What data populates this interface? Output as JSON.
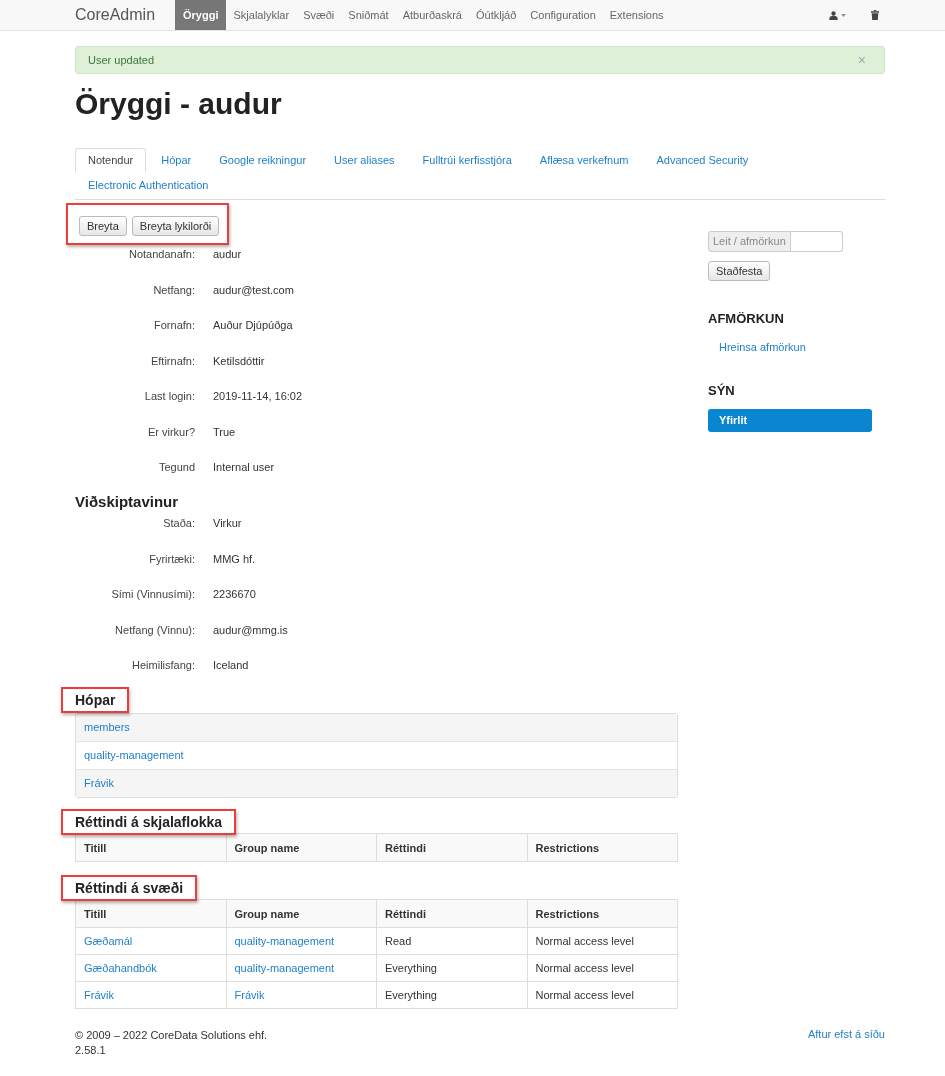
{
  "navbar": {
    "brand": "CoreAdmin",
    "items": [
      {
        "label": "Öryggi",
        "selected": true
      },
      {
        "label": "Skjalalyklar",
        "selected": false
      },
      {
        "label": "Svæði",
        "selected": false
      },
      {
        "label": "Sniðmát",
        "selected": false
      },
      {
        "label": "Atburðaskrá",
        "selected": false
      },
      {
        "label": "Óútkljáð",
        "selected": false
      },
      {
        "label": "Configuration",
        "selected": false
      },
      {
        "label": "Extensions",
        "selected": false
      }
    ]
  },
  "alert": {
    "message": "User updated",
    "close": "×"
  },
  "title": "Öryggi - audur",
  "tabs": [
    {
      "label": "Notendur",
      "selected": true
    },
    {
      "label": "Hópar",
      "selected": false
    },
    {
      "label": "Google reikningur",
      "selected": false
    },
    {
      "label": "User aliases",
      "selected": false
    },
    {
      "label": "Fulltrúi kerfisstjóra",
      "selected": false
    },
    {
      "label": "Aflæsa verkefnum",
      "selected": false
    },
    {
      "label": "Advanced Security",
      "selected": false
    },
    {
      "label": "Electronic Authentication",
      "selected": false
    }
  ],
  "actions": {
    "highlighted": true,
    "buttons": [
      "Breyta",
      "Breyta lykilorði"
    ]
  },
  "user_fields": [
    {
      "label": "Notandanafn:",
      "value": "audur"
    },
    {
      "label": "Netfang:",
      "value": "audur@test.com"
    },
    {
      "label": "Fornafn:",
      "value": "Auður Djúpúðga"
    },
    {
      "label": "Eftirnafn:",
      "value": "Ketilsdóttir"
    },
    {
      "label": "Last login:",
      "value": "2019-11-14, 16:02"
    },
    {
      "label": "Er virkur?",
      "value": "True"
    },
    {
      "label": "Tegund",
      "value": "Internal user"
    }
  ],
  "customer": {
    "heading": "Viðskiptavinur",
    "fields": [
      {
        "label": "Staða:",
        "value": "Virkur"
      },
      {
        "label": "Fyrirtæki:",
        "value": "MMG hf."
      },
      {
        "label": "Sími (Vinnusími):",
        "value": "2236670"
      },
      {
        "label": "Netfang (Vinnu):",
        "value": "audur@mmg.is"
      },
      {
        "label": "Heimilisfang:",
        "value": "Iceland"
      }
    ]
  },
  "groups": {
    "heading": "Hópar",
    "highlighted": true,
    "items": [
      "members",
      "quality-management",
      "Frávik"
    ]
  },
  "permission_tables": [
    {
      "heading": "Réttindi á skjalaflokka",
      "highlighted": true,
      "columns": [
        "Titill",
        "Group name",
        "Réttindi",
        "Restrictions"
      ]
    },
    {
      "heading": "Réttindi á svæði",
      "highlighted": true,
      "columns": [
        "Titill",
        "Group name",
        "Réttindi",
        "Restrictions"
      ],
      "rows": [
        [
          "Gæðamál",
          "quality-management",
          "Read",
          "Normal access level"
        ],
        [
          "Gæðahandbók",
          "quality-management",
          "Everything",
          "Normal access level"
        ],
        [
          "Frávik",
          "Frávik",
          "Everything",
          "Normal access level"
        ]
      ]
    }
  ],
  "sidebar": {
    "search_label": "Leit / afmörkun",
    "confirm_button": "Staðfesta",
    "filter_heading": "AFMÖRKUN",
    "clear_filter": "Hreinsa afmörkun",
    "view_heading": "SÝN",
    "views": [
      {
        "label": "Yfirlit",
        "selected": true
      }
    ]
  },
  "footer": {
    "copyright": "© 2009 – 2022 CoreData Solutions ehf.",
    "version": "2.58.1",
    "back_to_top": "Aftur efst á síðu"
  }
}
